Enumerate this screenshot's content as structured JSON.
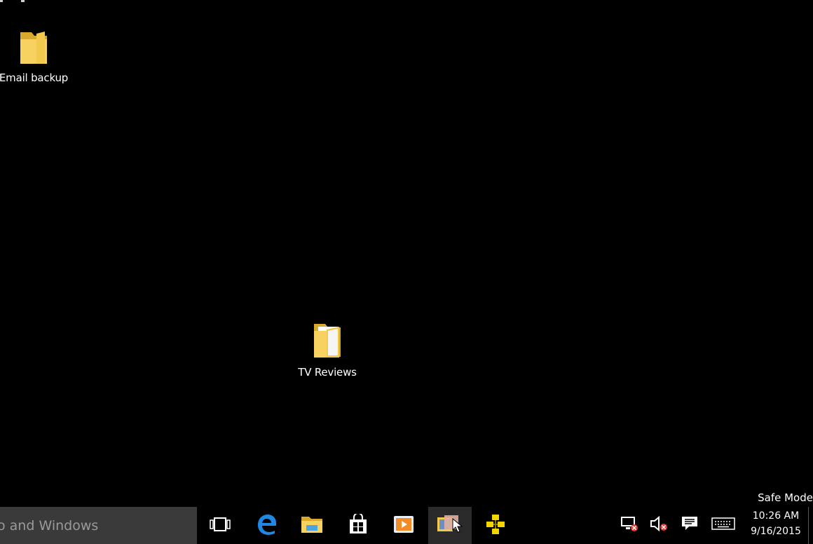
{
  "desktop": {
    "icons": [
      {
        "label": "Email backup",
        "icon": "folder-icon"
      },
      {
        "label": "TV Reviews",
        "icon": "folder-open-icon"
      }
    ],
    "watermark": "Safe Mode"
  },
  "taskbar": {
    "search_placeholder": "o and Windows",
    "pinned": [
      {
        "name": "Task View",
        "icon": "task-view-icon"
      },
      {
        "name": "Microsoft Edge",
        "icon": "edge-icon"
      },
      {
        "name": "File Explorer",
        "icon": "file-explorer-icon"
      },
      {
        "name": "Store",
        "icon": "store-icon"
      },
      {
        "name": "Media Player",
        "icon": "media-player-icon"
      },
      {
        "name": "Photos",
        "icon": "photos-icon",
        "active": true
      },
      {
        "name": "Network App",
        "icon": "network-app-icon"
      }
    ],
    "tray": [
      {
        "name": "Network (disconnected)",
        "icon": "network-disconnected-icon"
      },
      {
        "name": "Volume (muted)",
        "icon": "volume-muted-icon"
      },
      {
        "name": "Action Center",
        "icon": "action-center-icon"
      },
      {
        "name": "Touch Keyboard",
        "icon": "keyboard-icon"
      }
    ],
    "clock": {
      "time": "10:26 AM",
      "date": "9/16/2015"
    }
  },
  "colors": {
    "desktop_background": "#000000",
    "search_background": "#3a3a3a",
    "folder_yellow": "#f2c94c",
    "edge_blue": "#1e88e5",
    "tray_red": "#e53935"
  }
}
